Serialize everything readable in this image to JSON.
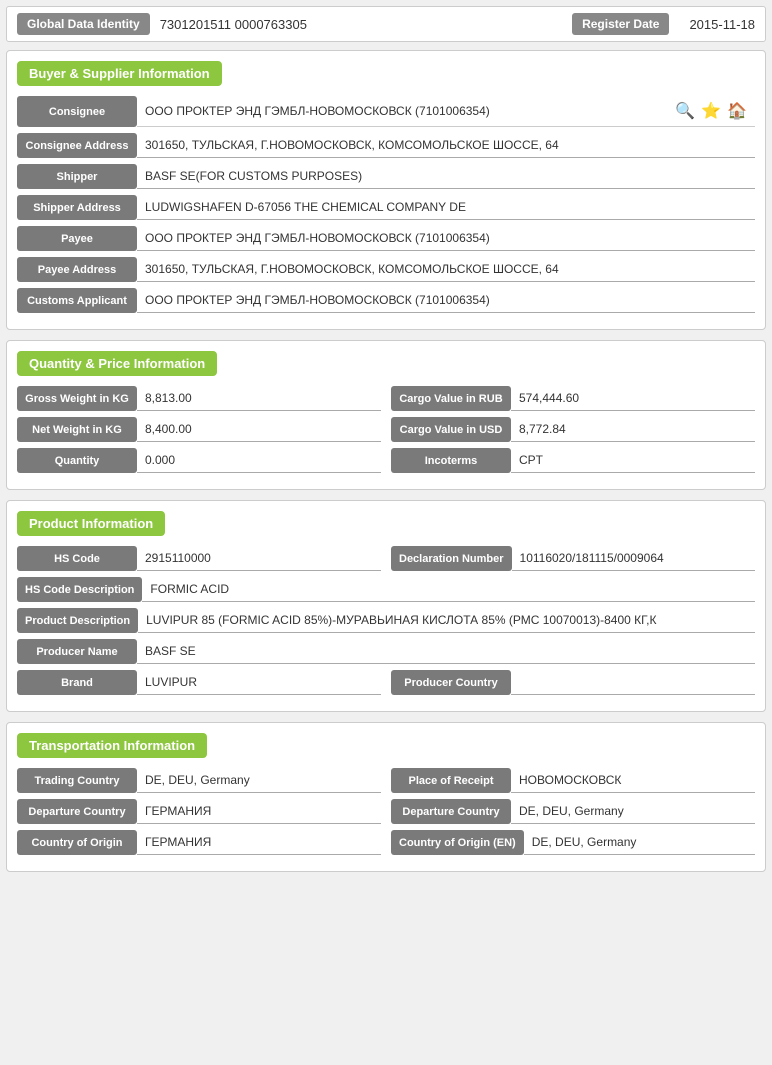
{
  "header": {
    "global_data_identity_label": "Global Data Identity",
    "global_data_identity_value": "7301201511 0000763305",
    "register_date_label": "Register Date",
    "register_date_value": "2015-11-18"
  },
  "buyer_supplier": {
    "section_title": "Buyer & Supplier Information",
    "consignee_label": "Consignee",
    "consignee_value": "ООО ПРОКТЕР ЭНД ГЭМБЛ-НОВОМОСКОВСК (7101006354)",
    "consignee_address_label": "Consignee Address",
    "consignee_address_value": "301650, ТУЛЬСКАЯ, Г.НОВОМОСКОВСК, КОМСОМОЛЬСКОЕ ШОССЕ, 64",
    "shipper_label": "Shipper",
    "shipper_value": "BASF SE(FOR CUSTOMS PURPOSES)",
    "shipper_address_label": "Shipper Address",
    "shipper_address_value": "LUDWIGSHAFEN D-67056 THE CHEMICAL COMPANY DE",
    "payee_label": "Payee",
    "payee_value": "ООО ПРОКТЕР ЭНД ГЭМБЛ-НОВОМОСКОВСК (7101006354)",
    "payee_address_label": "Payee Address",
    "payee_address_value": "301650, ТУЛЬСКАЯ, Г.НОВОМОСКОВСК, КОМСОМОЛЬСКОЕ ШОССЕ, 64",
    "customs_applicant_label": "Customs Applicant",
    "customs_applicant_value": "ООО ПРОКТЕР ЭНД ГЭМБЛ-НОВОМОСКОВСК (7101006354)"
  },
  "quantity_price": {
    "section_title": "Quantity & Price Information",
    "gross_weight_label": "Gross Weight in KG",
    "gross_weight_value": "8,813.00",
    "cargo_value_rub_label": "Cargo Value in RUB",
    "cargo_value_rub_value": "574,444.60",
    "net_weight_label": "Net Weight in KG",
    "net_weight_value": "8,400.00",
    "cargo_value_usd_label": "Cargo Value in USD",
    "cargo_value_usd_value": "8,772.84",
    "quantity_label": "Quantity",
    "quantity_value": "0.000",
    "incoterms_label": "Incoterms",
    "incoterms_value": "CPT"
  },
  "product": {
    "section_title": "Product Information",
    "hs_code_label": "HS Code",
    "hs_code_value": "2915110000",
    "declaration_number_label": "Declaration Number",
    "declaration_number_value": "10116020/181115/0009064",
    "hs_code_desc_label": "HS Code Description",
    "hs_code_desc_value": "FORMIC ACID",
    "product_desc_label": "Product Description",
    "product_desc_value": "LUVIPUR 85 (FORMIC ACID 85%)-МУРАВЬИНАЯ КИСЛОТА 85% (РМС 10070013)-8400 КГ,К",
    "producer_name_label": "Producer Name",
    "producer_name_value": "BASF SE",
    "brand_label": "Brand",
    "brand_value": "LUVIPUR",
    "producer_country_label": "Producer Country",
    "producer_country_value": ""
  },
  "transportation": {
    "section_title": "Transportation Information",
    "trading_country_label": "Trading Country",
    "trading_country_value": "DE, DEU, Germany",
    "place_of_receipt_label": "Place of Receipt",
    "place_of_receipt_value": "НОВОМОСКОВСК",
    "departure_country_label": "Departure Country",
    "departure_country_value": "ГЕРМАНИЯ",
    "departure_country_en_label": "Departure Country",
    "departure_country_en_value": "DE, DEU, Germany",
    "country_of_origin_label": "Country of Origin",
    "country_of_origin_value": "ГЕРМАНИЯ",
    "country_of_origin_en_label": "Country of Origin (EN)",
    "country_of_origin_en_value": "DE, DEU, Germany"
  },
  "icons": {
    "search": "🔍",
    "star": "⭐",
    "home": "🏠"
  }
}
